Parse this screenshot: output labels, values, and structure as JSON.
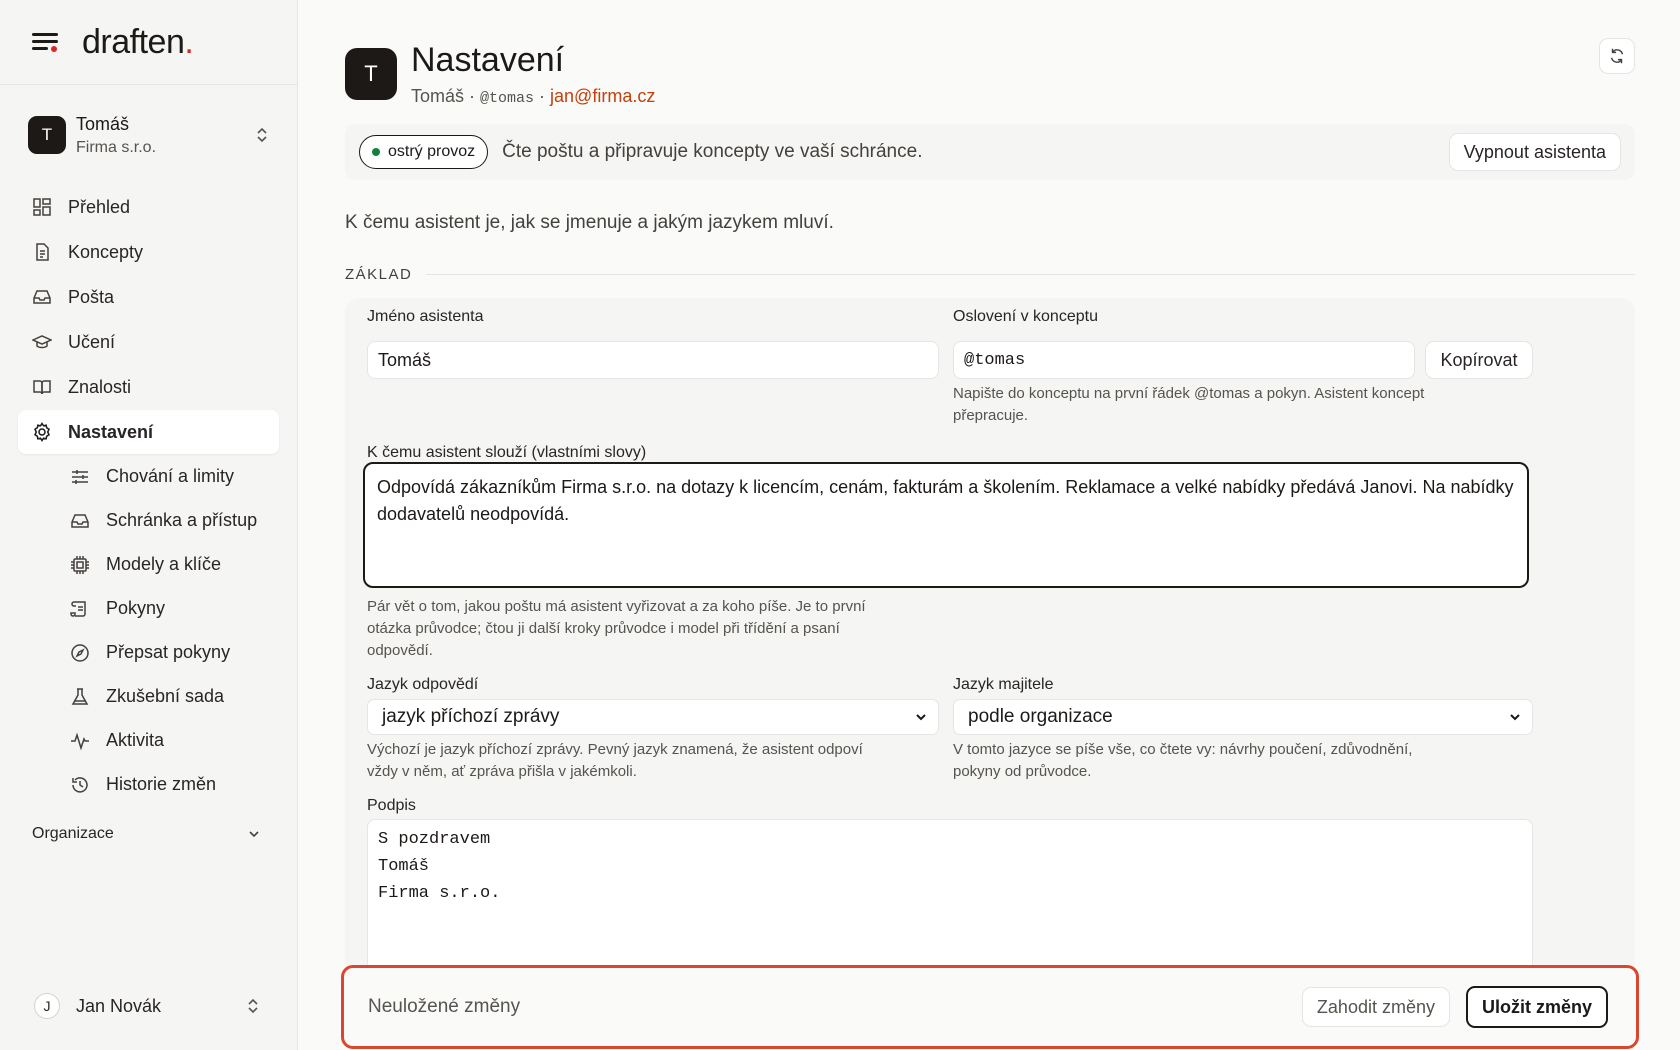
{
  "brand": {
    "name": "draften",
    "dot": "."
  },
  "account": {
    "initial": "T",
    "name": "Tomáš",
    "company": "Firma s.r.o."
  },
  "nav": [
    {
      "label": "Přehled",
      "icon": "dashboard-icon"
    },
    {
      "label": "Koncepty",
      "icon": "document-icon"
    },
    {
      "label": "Pošta",
      "icon": "inbox-icon"
    },
    {
      "label": "Učení",
      "icon": "graduation-cap-icon"
    },
    {
      "label": "Znalosti",
      "icon": "book-icon"
    },
    {
      "label": "Nastavení",
      "icon": "gear-icon",
      "active": true
    }
  ],
  "subnav": [
    {
      "label": "Chování a limity",
      "icon": "sliders-icon"
    },
    {
      "label": "Schránka a přístup",
      "icon": "inbox-icon"
    },
    {
      "label": "Modely a klíče",
      "icon": "chip-icon"
    },
    {
      "label": "Pokyny",
      "icon": "scroll-icon"
    },
    {
      "label": "Přepsat pokyny",
      "icon": "compass-icon"
    },
    {
      "label": "Zkušební sada",
      "icon": "flask-icon"
    },
    {
      "label": "Aktivita",
      "icon": "activity-icon"
    },
    {
      "label": "Historie změn",
      "icon": "history-icon"
    }
  ],
  "org": {
    "label": "Organizace"
  },
  "user": {
    "initial": "J",
    "name": "Jan Novák"
  },
  "header": {
    "initial": "T",
    "title": "Nastavení",
    "name": "Tomáš",
    "sep1": " · ",
    "handle": "@tomas",
    "sep2": " · ",
    "email": "jan@firma.cz"
  },
  "status": {
    "badge": "ostrý provoz",
    "text": "Čte poštu a připravuje koncepty ve vaší schránce.",
    "button": "Vypnout asistenta"
  },
  "intro": "K čemu asistent je, jak se jmenuje a jakým jazykem mluví.",
  "section": "ZÁKLAD",
  "form": {
    "name_label": "Jméno asistenta",
    "name_value": "Tomáš",
    "address_label": "Oslovení v konceptu",
    "address_value": "@tomas",
    "copy_button": "Kopírovat",
    "address_help": "Napište do konceptu na první řádek @tomas a pokyn. Asistent koncept přepracuje.",
    "purpose_label": "K čemu asistent slouží (vlastními slovy)",
    "purpose_value": "Odpovídá zákazníkům Firma s.r.o. na dotazy k licencím, cenám, fakturám a školením. Reklamace a velké nabídky předává Janovi. Na nabídky dodavatelů neodpovídá.",
    "purpose_help": "Pár vět o tom, jakou poštu má asistent vyřizovat a za koho píše. Je to první otázka průvodce; čtou ji další kroky průvodce i model při třídění a psaní odpovědí.",
    "reply_lang_label": "Jazyk odpovědí",
    "reply_lang_value": "jazyk příchozí zprávy",
    "reply_lang_help": "Výchozí je jazyk příchozí zprávy. Pevný jazyk znamená, že asistent odpoví vždy v něm, ať zpráva přišla v jakémkoli.",
    "owner_lang_label": "Jazyk majitele",
    "owner_lang_value": "podle organizace",
    "owner_lang_help": "V tomto jazyce se píše vše, co čtete vy: návrhy poučení, zdůvodnění, pokyny od průvodce.",
    "signature_label": "Podpis",
    "signature_value": "S pozdravem\nTomáš\nFirma s.r.o."
  },
  "savebar": {
    "text": "Neuložené změny",
    "discard": "Zahodit změny",
    "save": "Uložit změny"
  },
  "colors": {
    "accent": "#d9472f",
    "live": "#15803d",
    "email": "#c2410c"
  }
}
